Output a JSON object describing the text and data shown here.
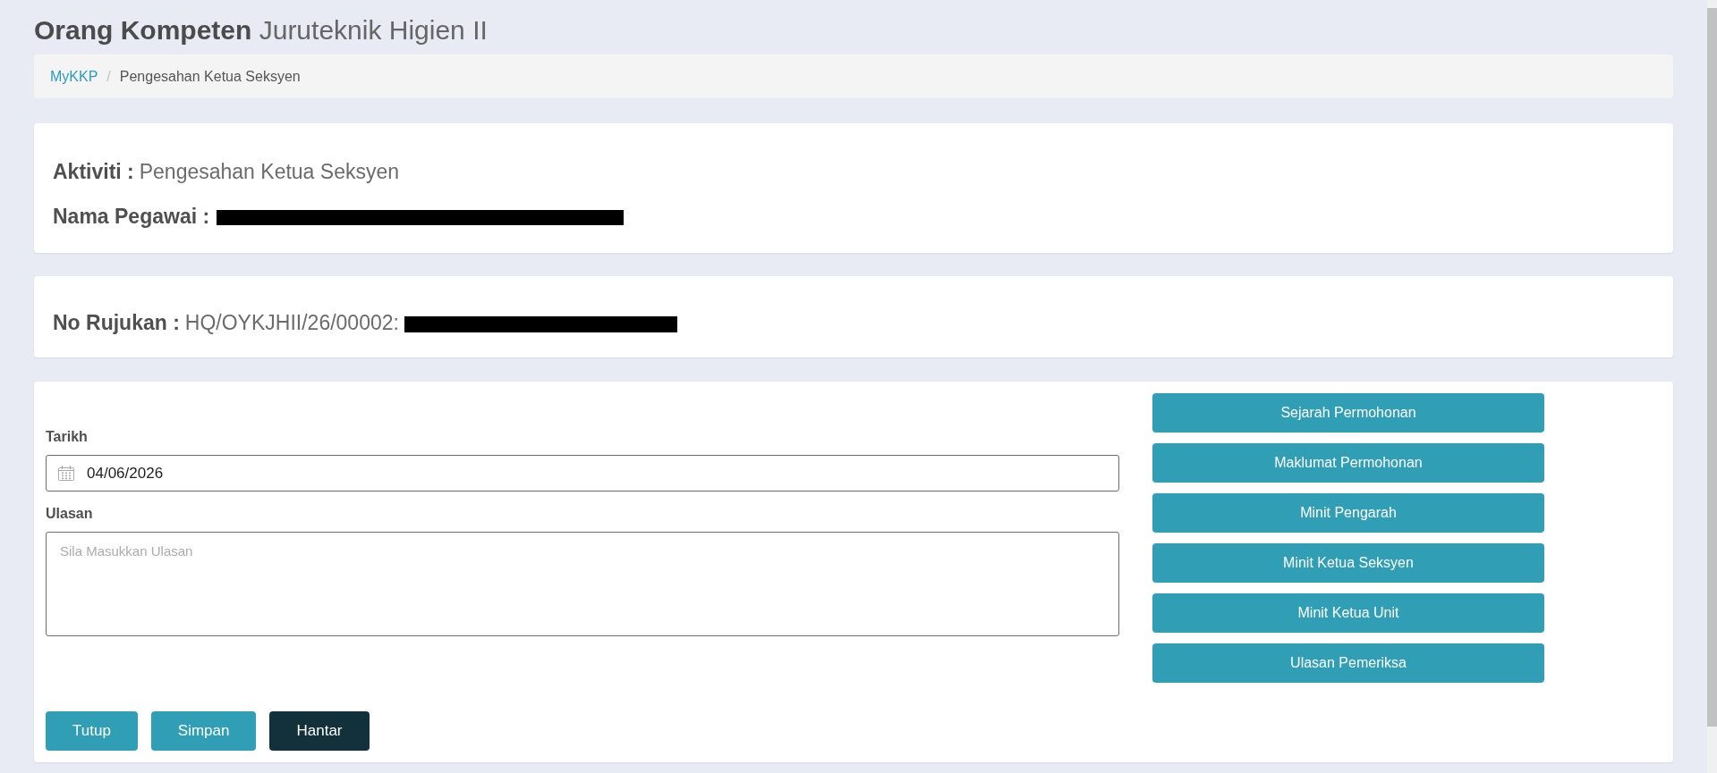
{
  "page_title": "**Orang Kompeten** Juruteknik Higien II",
  "breadcrumb": {
    "separator": "/",
    "items": [
      {
        "label": "MyKKP",
        "kind": "link"
      },
      {
        "label": "Pengesahan Ketua Seksyen",
        "kind": "current"
      }
    ]
  },
  "info_cards": [
    {
      "fields": [
        {
          "label": "Aktiviti :",
          "value": "Pengesahan Ketua Seksyen",
          "redacted": false
        },
        {
          "label": "Nama Pegawai :",
          "redacted": true
        }
      ]
    },
    {
      "fields": [
        {
          "label": "No Rujukan :",
          "value": "HQ/OYKJHII/26/00002:",
          "redacted": true
        }
      ]
    }
  ],
  "form": {
    "fields": [
      {
        "kind": "date",
        "label": "Tarikh",
        "value": "04/06/2026"
      },
      {
        "kind": "textarea",
        "label": "Ulasan",
        "placeholder": "Sila Masukkan Ulasan"
      }
    ],
    "actions": [
      {
        "label": "Tutup",
        "kind": "secondary"
      },
      {
        "label": "Simpan",
        "kind": "secondary"
      },
      {
        "label": "Hantar",
        "kind": "primary"
      }
    ]
  },
  "side_buttons": [
    "Sejarah Permohonan",
    "Maklumat Permohonan",
    "Minit Pengarah",
    "Minit Ketua Seksyen",
    "Minit Ketua Unit",
    "Ulasan Pemeriksa"
  ]
}
